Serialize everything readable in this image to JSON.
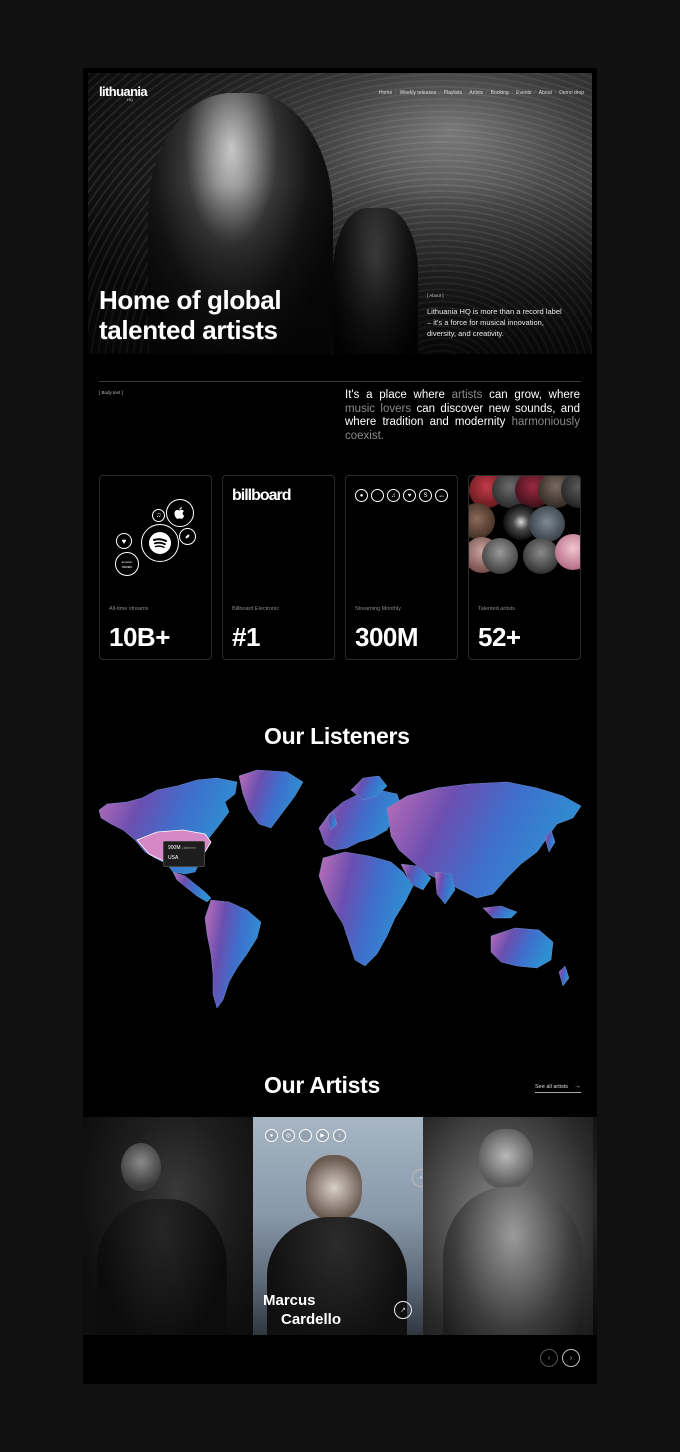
{
  "brand": {
    "logo": "lithuania",
    "logo_sub": "HQ"
  },
  "nav": {
    "items": [
      "Home",
      "Weekly releases",
      "Playlists",
      "Artists",
      "Booking",
      "Events",
      "About",
      "Demo drop"
    ],
    "separator": "/"
  },
  "hero": {
    "title_line1": "Home of global",
    "title_line2": "talented artists",
    "tag": "[ About ]",
    "description": "Lithuania HQ is more than a record label – it's a force for musical innovation, diversity, and creativity."
  },
  "body_section": {
    "tag": "[ Body text ]",
    "text_parts": [
      {
        "text": "It's a place where ",
        "dim": false
      },
      {
        "text": "artists",
        "dim": true
      },
      {
        "text": " can grow, where ",
        "dim": false
      },
      {
        "text": "music lovers",
        "dim": true
      },
      {
        "text": " can discover new sounds, and where tradition and modernity ",
        "dim": false
      },
      {
        "text": "harmoniously coexist.",
        "dim": true
      }
    ]
  },
  "stats": [
    {
      "label": "All-time streams",
      "value": "10B+"
    },
    {
      "label": "Billboard Electronic",
      "value": "#1",
      "logo": "billboard"
    },
    {
      "label": "Streaming Monthly",
      "value": "300M"
    },
    {
      "label": "Talented artists",
      "value": "52+"
    }
  ],
  "listeners": {
    "title": "Our Listeners",
    "tooltip": {
      "value": "900M",
      "unit": "Listeners",
      "country": "USA"
    }
  },
  "artists": {
    "title": "Our Artists",
    "see_all": "See all artists",
    "featured_name_line1": "Marcus",
    "featured_name_line2": "Cardello"
  },
  "colors": {
    "background": "#111111",
    "page": "#000000",
    "map_pink": "#c070b8",
    "map_purple": "#6a4fb0",
    "map_blue": "#2e8fd2",
    "muted_text": "#8a8a8a"
  }
}
